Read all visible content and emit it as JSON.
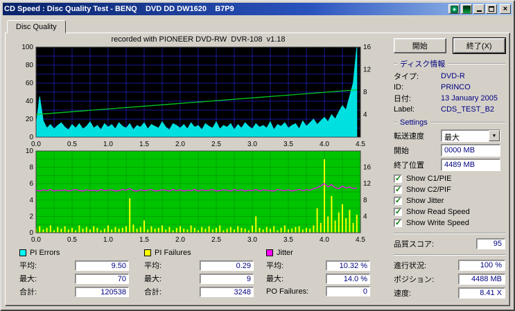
{
  "window": {
    "title": "CD Speed : Disc Quality Test - BENQ    DVD DD DW1620    B7P9",
    "controls": {
      "minimize": "minimize",
      "maximize": "maximize",
      "close": "×"
    }
  },
  "tabs": [
    {
      "label": "Disc Quality"
    }
  ],
  "chart_data": [
    {
      "type": "area",
      "title": "recorded with PIONEER DVD-RW  DVR-108  v1.18",
      "x0": 0,
      "dx": 0.05,
      "xlim": [
        0,
        4.5
      ],
      "ylim": [
        0,
        100
      ],
      "x_grid_step": 0.25,
      "y_grid_step": 10,
      "bg": "#000000",
      "grid": "#2222cc",
      "left_ticks": [
        0,
        20,
        40,
        60,
        80,
        100
      ],
      "right_ticks": [
        4,
        8,
        12,
        16
      ],
      "right_scale": 6.25,
      "x_ticks": [
        "0.0",
        "0.5",
        "1.0",
        "1.5",
        "2.0",
        "2.5",
        "3.0",
        "3.5",
        "4.0",
        "4.5"
      ],
      "series": [
        {
          "name": "C1/PIE errors",
          "style": "area",
          "color": "#00e0e0",
          "scale": 1,
          "values": [
            12,
            45,
            18,
            10,
            14,
            9,
            13,
            16,
            11,
            8,
            14,
            10,
            15,
            9,
            12,
            17,
            10,
            13,
            8,
            15,
            11,
            14,
            9,
            16,
            12,
            10,
            15,
            8,
            13,
            11,
            16,
            9,
            14,
            12,
            10,
            17,
            11,
            8,
            15,
            13,
            10,
            14,
            9,
            16,
            11,
            13,
            8,
            15,
            12,
            10,
            17,
            9,
            13,
            11,
            15,
            8,
            14,
            10,
            16,
            12,
            9,
            15,
            11,
            13,
            10,
            17,
            8,
            14,
            12,
            16,
            10,
            13,
            15,
            9,
            18,
            12,
            16,
            20,
            14,
            18,
            22,
            17,
            25,
            20,
            28,
            35,
            30,
            45,
            60,
            100
          ]
        },
        {
          "name": "Write Speed (X)",
          "style": "line",
          "color": "#00cc22",
          "scale": 6.25,
          "points": [
            [
              0,
              4.02
            ],
            [
              4.45,
              8.41
            ]
          ]
        }
      ]
    },
    {
      "type": "bars",
      "title": "",
      "x0": 0,
      "dx": 0.05,
      "xlim": [
        0,
        4.5
      ],
      "ylim": [
        0,
        10
      ],
      "x_grid_step": 0.25,
      "y_grid_step": 1,
      "bg": "#00c400",
      "grid": "#009600",
      "left_ticks": [
        0,
        2,
        4,
        6,
        8,
        10
      ],
      "right_ticks": [
        4,
        8,
        12,
        16
      ],
      "right_scale": 0.5,
      "x_ticks": [
        "0.0",
        "0.5",
        "1.0",
        "1.5",
        "2.0",
        "2.5",
        "3.0",
        "3.5",
        "4.0",
        "4.5"
      ],
      "series": [
        {
          "name": "C2/PIF errors",
          "style": "bars",
          "color": "#ffff00",
          "scale": 1,
          "values": [
            0.5,
            0.8,
            0.4,
            0.6,
            0.9,
            0.3,
            0.7,
            0.5,
            0.8,
            0.4,
            0.6,
            0.3,
            0.9,
            0.5,
            0.7,
            0.4,
            0.8,
            0.6,
            0.3,
            0.5,
            0.9,
            0.4,
            0.7,
            0.5,
            0.6,
            0.8,
            4.2,
            1.0,
            0.5,
            0.7,
            1.5,
            0.4,
            0.8,
            0.5,
            0.6,
            0.9,
            0.4,
            0.7,
            0.3,
            0.6,
            0.8,
            0.5,
            0.4,
            0.9,
            0.6,
            0.3,
            0.7,
            0.5,
            0.8,
            0.4,
            0.6,
            0.9,
            0.3,
            0.5,
            0.7,
            0.4,
            0.8,
            0.6,
            0.5,
            0.3,
            0.9,
            2.0,
            0.6,
            0.4,
            0.7,
            0.5,
            0.8,
            0.3,
            0.6,
            0.9,
            0.4,
            0.5,
            0.7,
            0.8,
            0.4,
            0.6,
            0.5,
            0.9,
            3.0,
            1.2,
            9.0,
            2.0,
            4.5,
            1.5,
            2.5,
            3.5,
            1.8,
            2.8,
            1.2,
            2.2
          ]
        },
        {
          "name": "Jitter (%)",
          "style": "line",
          "color": "#ff00ff",
          "scale": 0.5,
          "values": [
            10.4,
            10.2,
            10.5,
            10.3,
            10.6,
            10.2,
            10.4,
            10.3,
            10.5,
            10.2,
            10.4,
            10.6,
            10.3,
            10.2,
            10.5,
            10.3,
            10.4,
            10.2,
            10.6,
            10.3,
            10.4,
            10.5,
            10.2,
            10.3,
            10.6,
            10.4,
            10.8,
            10.3,
            10.2,
            10.5,
            10.3,
            10.4,
            10.6,
            10.2,
            10.3,
            10.5,
            10.4,
            10.2,
            10.6,
            10.3,
            10.5,
            10.2,
            10.4,
            10.3,
            10.6,
            10.2,
            10.5,
            10.3,
            10.4,
            10.6,
            10.2,
            10.3,
            10.5,
            10.4,
            10.2,
            10.6,
            10.3,
            10.5,
            10.2,
            10.4,
            10.3,
            10.6,
            10.2,
            10.5,
            10.4,
            10.3,
            10.2,
            10.6,
            10.4,
            10.3,
            10.5,
            10.2,
            10.4,
            10.6,
            10.3,
            10.5,
            10.4,
            10.8,
            11.0,
            11.5,
            12.0,
            11.2,
            11.8,
            11.0,
            10.8,
            11.4,
            10.9,
            11.2,
            10.8,
            11.0
          ]
        }
      ]
    }
  ],
  "stats": {
    "pi_errors": {
      "legend": "PI Errors",
      "color": "#00ffff",
      "rows": [
        {
          "label": "平均:",
          "value": "9.50"
        },
        {
          "label": "最大:",
          "value": "70"
        },
        {
          "label": "合計:",
          "value": "120538"
        }
      ]
    },
    "pi_failures": {
      "legend": "PI Failures",
      "color": "#ffff00",
      "rows": [
        {
          "label": "平均:",
          "value": "0.29"
        },
        {
          "label": "最大:",
          "value": "9"
        },
        {
          "label": "合計:",
          "value": "3248"
        }
      ]
    },
    "jitter": {
      "legend": "Jitter",
      "color": "#ff00ff",
      "rows": [
        {
          "label": "平均:",
          "value": "10.32 %"
        },
        {
          "label": "最大:",
          "value": "14.0 %"
        },
        {
          "label": "PO Failures:",
          "value": "0"
        }
      ]
    }
  },
  "panel": {
    "start_button": "開始",
    "exit_button": "終了(X)",
    "disc_info": {
      "header": "ディスク情報",
      "rows": [
        {
          "label": "タイプ:",
          "value": "DVD-R"
        },
        {
          "label": "ID:",
          "value": "PRINCO"
        },
        {
          "label": "日付:",
          "value": "13 January 2005"
        },
        {
          "label": "Label:",
          "value": "CDS_TEST_B2"
        }
      ]
    },
    "settings": {
      "header": "Settings",
      "speed_label": "転送速度",
      "speed_value": "最大",
      "start_label": "開始",
      "start_value": "0000 MB",
      "end_label": "終了位置",
      "end_value": "4489 MB",
      "checkboxes": [
        {
          "label": "Show C1/PIE",
          "checked": true
        },
        {
          "label": "Show C2/PIF",
          "checked": true
        },
        {
          "label": "Show Jitter",
          "checked": true
        },
        {
          "label": "Show Read Speed",
          "checked": true
        },
        {
          "label": "Show Write Speed",
          "checked": true
        }
      ]
    },
    "quality": {
      "label": "品質スコア:",
      "value": "95"
    },
    "status": [
      {
        "label": "進行状況:",
        "value": "100 %"
      },
      {
        "label": "ポジション:",
        "value": "4488 MB"
      },
      {
        "label": "速度:",
        "value": "8.41 X"
      }
    ]
  }
}
